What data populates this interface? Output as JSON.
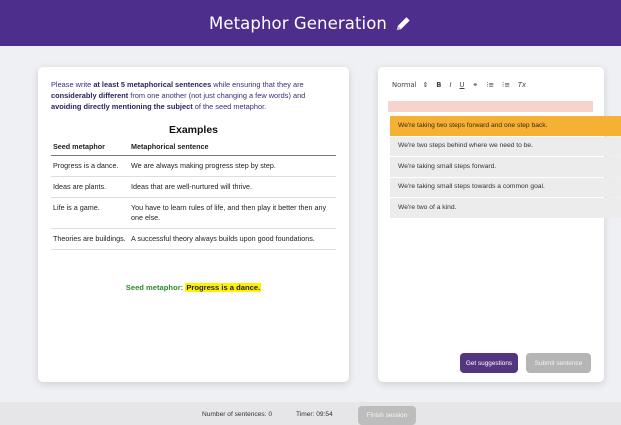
{
  "header": {
    "title": "Metaphor Generation",
    "icon": "pencil-icon"
  },
  "instructions": {
    "part1": "Please write ",
    "bold1": "at least 5 metaphorical sentences",
    "part2": " while ensuring that they are ",
    "bold2": "considerably different",
    "part3": " from one another (not just changing a few words) and ",
    "bold3": "avoiding directly mentioning the subject",
    "part4": " of the seed metaphor."
  },
  "examples": {
    "title": "Examples",
    "headers": [
      "Seed metaphor",
      "Metaphorical sentence"
    ],
    "rows": [
      [
        "Progress is a dance.",
        "We are always making progress step by step."
      ],
      [
        "Ideas are plants.",
        "Ideas that are well-nurtured will thrive."
      ],
      [
        "Life is a game.",
        "You have to learn rules of life, and then play it better then any one else."
      ],
      [
        "Theories are buildings.",
        "A successful theory always builds upon good foundations."
      ]
    ]
  },
  "seed": {
    "label": "Seed metaphor:",
    "value": "Progress is a dance."
  },
  "editor": {
    "toolbar": {
      "format": "Normal",
      "format_arrow": "⇕",
      "bold": "B",
      "italic": "I",
      "underline": "U",
      "link": "⚭",
      "ordered_list": "⁝≡",
      "bullet_list": "⁝≡",
      "clear_format": "Tx"
    }
  },
  "suggestions": [
    "We're taking two steps forward and one step back.",
    "We're two steps behind where we need to be.",
    "We're taking small steps forward.",
    "We're taking small steps towards a common goal.",
    "We're two of a kind."
  ],
  "buttons": {
    "get_suggestions": "Get suggestions",
    "submit_sentence": "Submit sentence",
    "finish_session": "Finish session"
  },
  "footer": {
    "sentences": "Number of sentences: 0",
    "timer": "Timer: 09:54"
  },
  "colors": {
    "header": "#4e2e8c",
    "highlight": "#fff200",
    "active_suggestion": "#f5b133",
    "seed_text": "#2a8c2a"
  }
}
